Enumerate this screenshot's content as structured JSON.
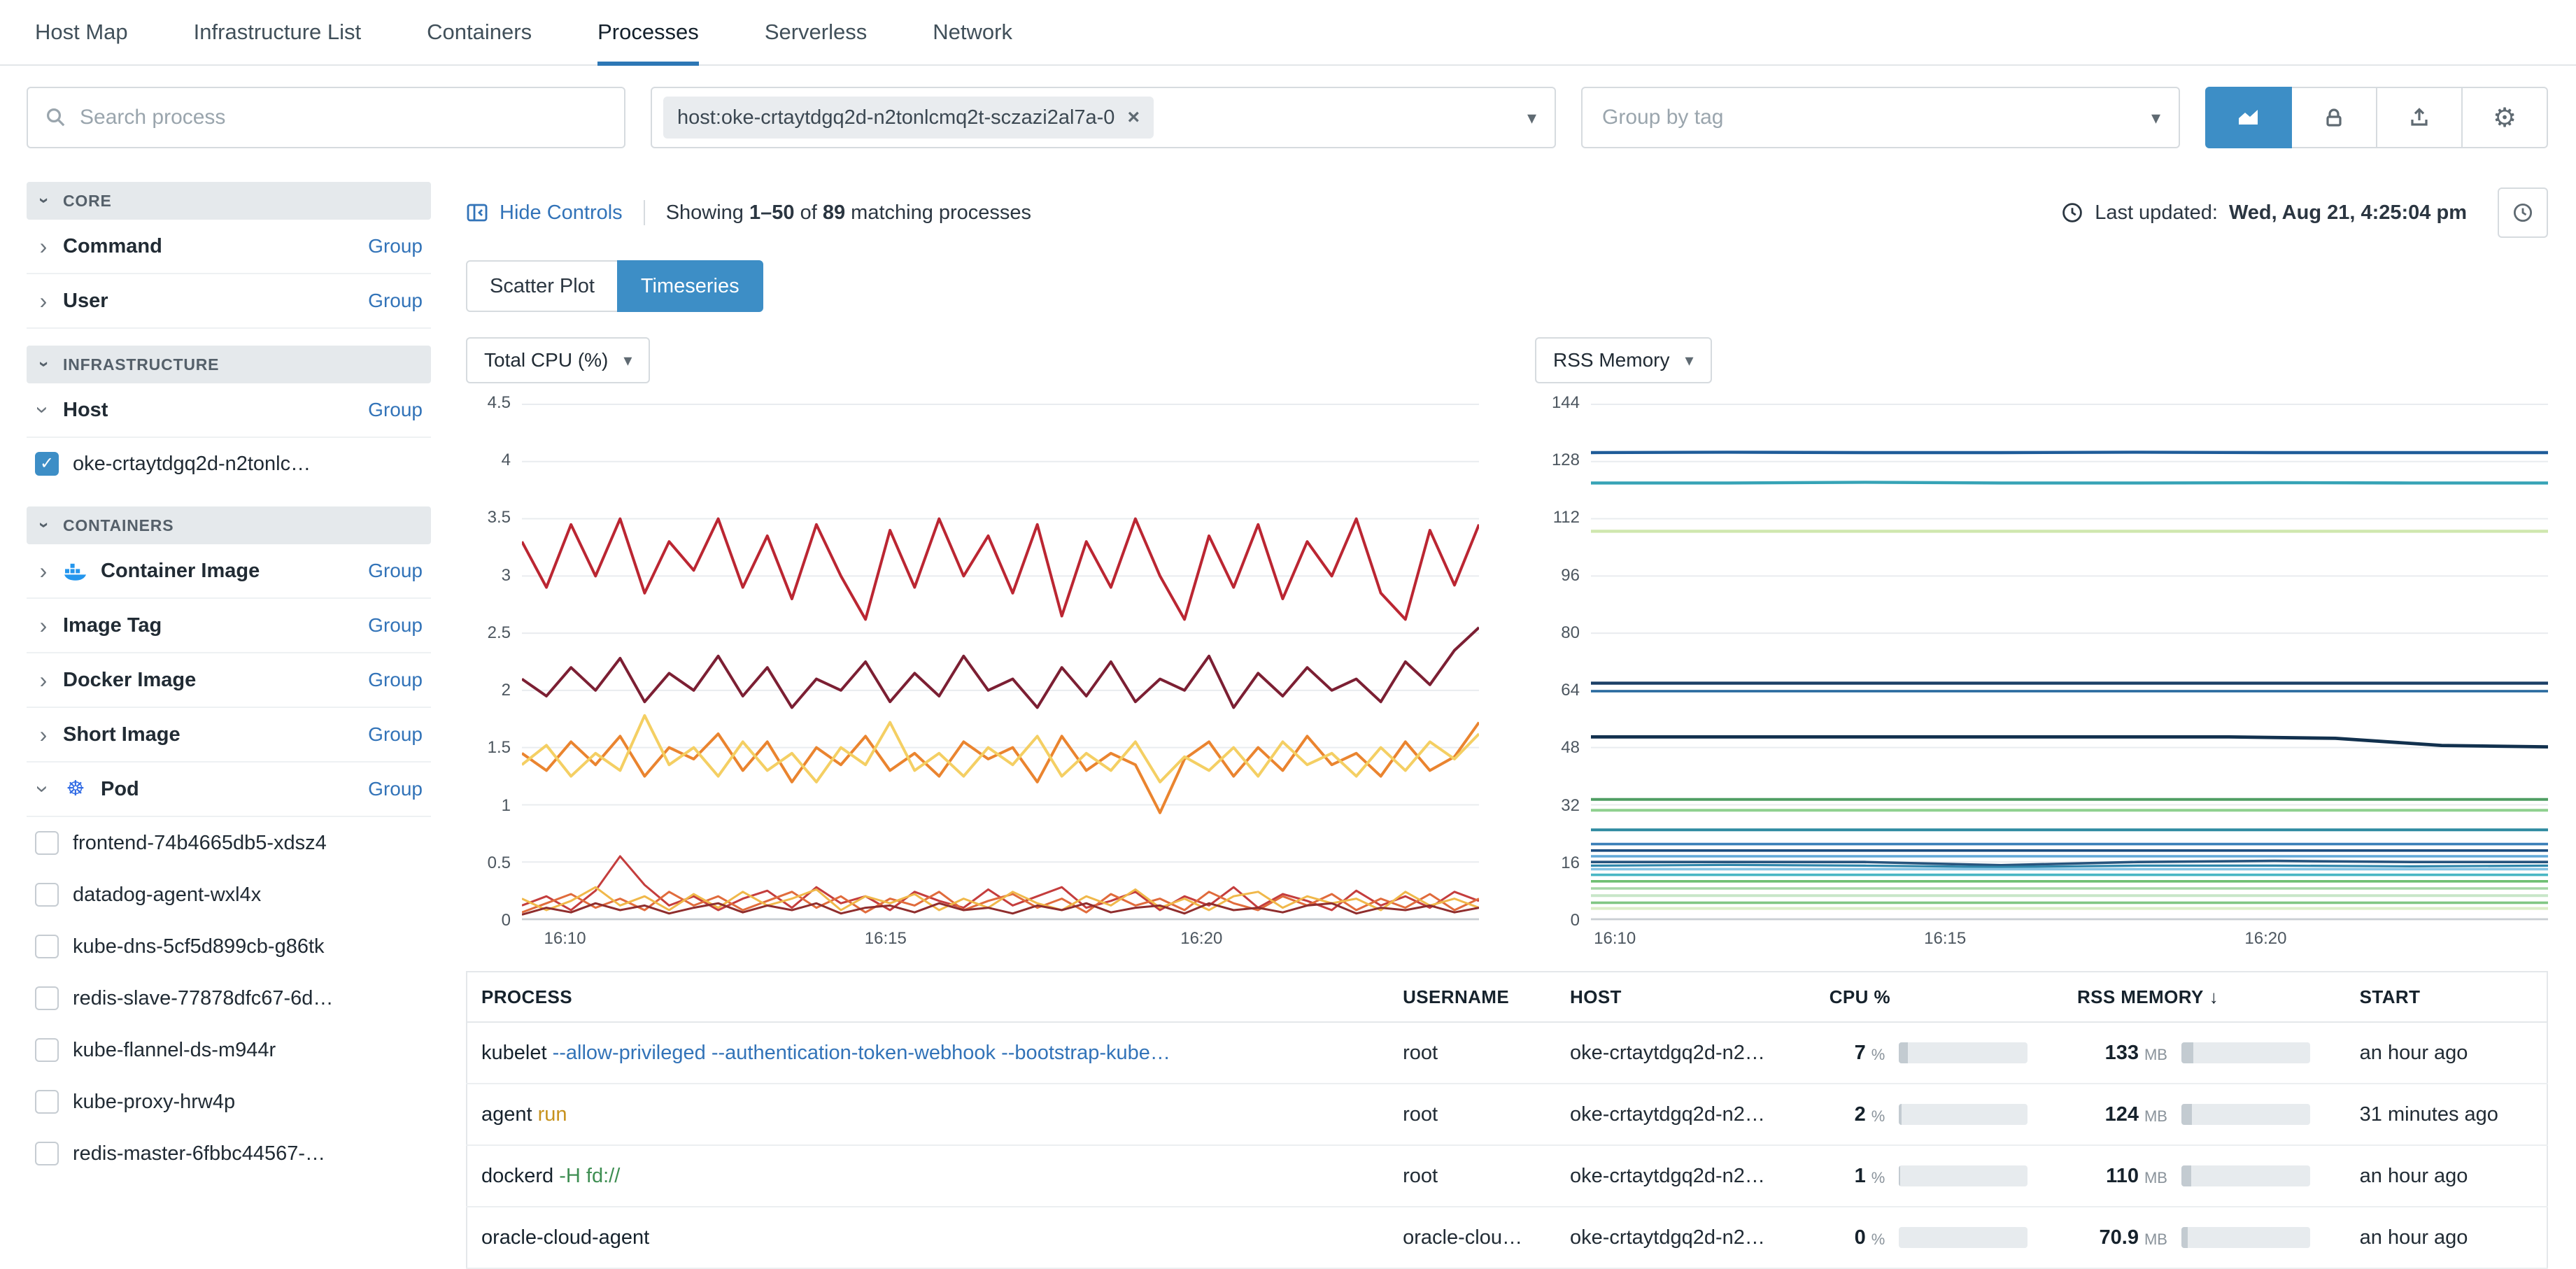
{
  "nav": {
    "items": [
      "Host Map",
      "Infrastructure List",
      "Containers",
      "Processes",
      "Serverless",
      "Network"
    ],
    "active": "Processes"
  },
  "toolbar": {
    "search_placeholder": "Search process",
    "filter_tag": "host:oke-crtaytdgq2d-n2tonlcmq2t-sczazi2al7a-0",
    "group_by_placeholder": "Group by tag"
  },
  "icons": {
    "chevron": "›",
    "caret": "▾",
    "close": "×",
    "check": "✓",
    "kubernetes": "☸",
    "gear": "⚙",
    "sort_desc": "↓"
  },
  "colors": {
    "accent": "#3d8ec6",
    "link": "#3273b8",
    "args_warn": "#c7921e",
    "args_ok": "#3e8e52",
    "docker_blue": "#2496ed",
    "kubernetes_blue": "#326ce5"
  },
  "sidebar": {
    "group_label": "Group",
    "sections": {
      "core": {
        "title": "CORE",
        "items": [
          {
            "label": "Command"
          },
          {
            "label": "User"
          }
        ]
      },
      "infrastructure": {
        "title": "INFRASTRUCTURE",
        "items": [
          {
            "label": "Host",
            "expanded": true,
            "children": [
              {
                "label": "oke-crtaytdgq2d-n2tonlc…",
                "checked": true
              }
            ]
          }
        ]
      },
      "containers": {
        "title": "CONTAINERS",
        "items": [
          {
            "label": "Container Image",
            "icon": "docker"
          },
          {
            "label": "Image Tag"
          },
          {
            "label": "Docker Image"
          },
          {
            "label": "Short Image"
          },
          {
            "label": "Pod",
            "icon": "kubernetes",
            "expanded": true,
            "children": [
              {
                "label": "frontend-74b4665db5-xdsz4",
                "checked": false
              },
              {
                "label": "datadog-agent-wxl4x",
                "checked": false
              },
              {
                "label": "kube-dns-5cf5d899cb-g86tk",
                "checked": false
              },
              {
                "label": "redis-slave-77878dfc67-6d…",
                "checked": false
              },
              {
                "label": "kube-flannel-ds-m944r",
                "checked": false
              },
              {
                "label": "kube-proxy-hrw4p",
                "checked": false
              },
              {
                "label": "redis-master-6fbbc44567-…",
                "checked": false
              }
            ]
          }
        ]
      }
    }
  },
  "controls": {
    "hide_controls": "Hide Controls",
    "showing_prefix": "Showing",
    "showing_range": "1–50",
    "showing_of": "of",
    "showing_total": "89",
    "showing_suffix": "matching processes",
    "last_updated_label": "Last updated:",
    "last_updated_value": "Wed, Aug 21, 4:25:04 pm"
  },
  "tabs": {
    "scatter": "Scatter Plot",
    "timeseries": "Timeseries",
    "active": "Timeseries"
  },
  "charts": [
    {
      "type": "line",
      "selector_label": "Total CPU (%)",
      "ylim": [
        0,
        4.5
      ],
      "y_ticks": [
        "4.5",
        "4",
        "3.5",
        "3",
        "2.5",
        "2",
        "1.5",
        "1",
        "0.5",
        "0"
      ],
      "x_ticks": [
        "16:10",
        "16:15",
        "16:20"
      ],
      "series": [
        {
          "color": "#bb2632",
          "w": 2,
          "values": [
            3.3,
            2.9,
            3.45,
            3.0,
            3.5,
            2.85,
            3.3,
            3.05,
            3.5,
            2.9,
            3.35,
            2.8,
            3.45,
            3.0,
            2.62,
            3.4,
            2.9,
            3.5,
            3.0,
            3.35,
            2.85,
            3.45,
            2.65,
            3.3,
            2.9,
            3.5,
            3.0,
            2.62,
            3.35,
            2.9,
            3.45,
            2.8,
            3.3,
            3.0,
            3.5,
            2.85,
            2.62,
            3.4,
            2.92,
            3.45
          ]
        },
        {
          "color": "#7c1f33",
          "w": 2,
          "values": [
            2.1,
            1.95,
            2.2,
            2.0,
            2.28,
            1.9,
            2.15,
            2.0,
            2.3,
            1.95,
            2.2,
            1.85,
            2.1,
            2.0,
            2.25,
            1.9,
            2.15,
            1.95,
            2.3,
            2.0,
            2.1,
            1.85,
            2.2,
            1.95,
            2.25,
            1.9,
            2.1,
            2.0,
            2.3,
            1.85,
            2.15,
            1.95,
            2.2,
            2.0,
            2.1,
            1.9,
            2.25,
            2.05,
            2.35,
            2.55
          ]
        },
        {
          "color": "#ea842f",
          "w": 2,
          "values": [
            1.45,
            1.3,
            1.55,
            1.35,
            1.6,
            1.25,
            1.5,
            1.4,
            1.62,
            1.3,
            1.55,
            1.2,
            1.5,
            1.35,
            1.6,
            1.3,
            1.45,
            1.25,
            1.55,
            1.4,
            1.5,
            1.2,
            1.6,
            1.3,
            1.45,
            1.35,
            0.93,
            1.4,
            1.55,
            1.25,
            1.5,
            1.3,
            1.6,
            1.35,
            1.45,
            1.25,
            1.55,
            1.3,
            1.42,
            1.72
          ]
        },
        {
          "color": "#f4cf63",
          "w": 2,
          "values": [
            1.35,
            1.52,
            1.25,
            1.45,
            1.3,
            1.78,
            1.35,
            1.5,
            1.25,
            1.55,
            1.3,
            1.45,
            1.2,
            1.5,
            1.35,
            1.72,
            1.3,
            1.45,
            1.25,
            1.5,
            1.35,
            1.6,
            1.25,
            1.45,
            1.3,
            1.55,
            1.2,
            1.42,
            1.3,
            1.5,
            1.25,
            1.55,
            1.35,
            1.45,
            1.25,
            1.5,
            1.3,
            1.55,
            1.4,
            1.62
          ]
        },
        {
          "color": "#c43d3d",
          "w": 1.5,
          "values": [
            0.12,
            0.2,
            0.08,
            0.25,
            0.55,
            0.3,
            0.12,
            0.2,
            0.08,
            0.18,
            0.25,
            0.1,
            0.28,
            0.14,
            0.2,
            0.08,
            0.24,
            0.16,
            0.1,
            0.26,
            0.12,
            0.2,
            0.28,
            0.1,
            0.16,
            0.24,
            0.08,
            0.2,
            0.12,
            0.28,
            0.1,
            0.22,
            0.16,
            0.08,
            0.25,
            0.12,
            0.2,
            0.1,
            0.24,
            0.16
          ]
        },
        {
          "color": "#e06b3c",
          "w": 1.5,
          "values": [
            0.06,
            0.14,
            0.22,
            0.1,
            0.18,
            0.08,
            0.24,
            0.12,
            0.2,
            0.08,
            0.16,
            0.24,
            0.1,
            0.2,
            0.06,
            0.18,
            0.12,
            0.24,
            0.08,
            0.16,
            0.22,
            0.1,
            0.18,
            0.06,
            0.22,
            0.12,
            0.18,
            0.08,
            0.24,
            0.14,
            0.08,
            0.2,
            0.12,
            0.22,
            0.08,
            0.18,
            0.1,
            0.22,
            0.08,
            0.18
          ]
        },
        {
          "color": "#f0b84a",
          "w": 1.5,
          "values": [
            0.18,
            0.08,
            0.16,
            0.28,
            0.12,
            0.2,
            0.08,
            0.22,
            0.1,
            0.24,
            0.12,
            0.18,
            0.26,
            0.08,
            0.2,
            0.14,
            0.22,
            0.08,
            0.18,
            0.1,
            0.24,
            0.14,
            0.08,
            0.2,
            0.12,
            0.26,
            0.1,
            0.18,
            0.08,
            0.2,
            0.24,
            0.1,
            0.2,
            0.14,
            0.18,
            0.08,
            0.24,
            0.12,
            0.18,
            0.1
          ]
        },
        {
          "color": "#8f2d2d",
          "w": 1.5,
          "values": [
            0.04,
            0.1,
            0.06,
            0.14,
            0.08,
            0.12,
            0.05,
            0.1,
            0.14,
            0.06,
            0.12,
            0.08,
            0.14,
            0.05,
            0.1,
            0.12,
            0.06,
            0.14,
            0.08,
            0.1,
            0.05,
            0.12,
            0.08,
            0.14,
            0.06,
            0.1,
            0.12,
            0.05,
            0.14,
            0.08,
            0.1,
            0.06,
            0.12,
            0.14,
            0.05,
            0.1,
            0.08,
            0.12,
            0.06,
            0.1
          ]
        }
      ]
    },
    {
      "type": "line",
      "selector_label": "RSS Memory",
      "ylim": [
        0,
        144
      ],
      "y_ticks": [
        "144",
        "128",
        "112",
        "96",
        "80",
        "64",
        "48",
        "32",
        "16",
        "0"
      ],
      "x_ticks": [
        "16:10",
        "16:15",
        "16:20"
      ],
      "series": [
        {
          "color": "#1f5c99",
          "w": 2.2,
          "values": [
            130.5,
            130.6,
            130.5,
            130.5,
            130.6,
            130.5,
            130.5,
            130.5
          ]
        },
        {
          "color": "#36a3b6",
          "w": 2.2,
          "values": [
            122,
            122,
            122.2,
            122,
            122,
            122.1,
            122,
            122
          ]
        },
        {
          "color": "#cfe7ae",
          "w": 2.2,
          "values": [
            108.5,
            108.5
          ]
        },
        {
          "color": "#1b3f66",
          "w": 2.2,
          "values": [
            66,
            66
          ]
        },
        {
          "color": "#27699e",
          "w": 1.8,
          "values": [
            63.8,
            63.8
          ]
        },
        {
          "color": "#12314e",
          "w": 2.4,
          "values": [
            51,
            51,
            51,
            51,
            51,
            51,
            51,
            50.6,
            48.6,
            48.2
          ]
        },
        {
          "color": "#4f9e63",
          "w": 2,
          "values": [
            33.5,
            33.5
          ]
        },
        {
          "color": "#8fd08f",
          "w": 2,
          "values": [
            30.5,
            30.5
          ]
        },
        {
          "color": "#2f8ba1",
          "w": 2,
          "values": [
            25,
            25
          ]
        },
        {
          "color": "#3a7fb8",
          "w": 1.8,
          "values": [
            21,
            21
          ]
        },
        {
          "color": "#1c4e80",
          "w": 1.8,
          "values": [
            19.2,
            19.2
          ]
        },
        {
          "color": "#62a8d8",
          "w": 1.8,
          "values": [
            17.6,
            17.6
          ]
        },
        {
          "color": "#27547d",
          "w": 1.8,
          "values": [
            16,
            16,
            16,
            15.1,
            16,
            16.3,
            16,
            16
          ]
        },
        {
          "color": "#2e86ab",
          "w": 1.6,
          "values": [
            15,
            15.2,
            15,
            14.6,
            15,
            15,
            14.8,
            15
          ]
        },
        {
          "color": "#86c3e3",
          "w": 1.8,
          "values": [
            14,
            14
          ]
        },
        {
          "color": "#49b6c4",
          "w": 1.8,
          "values": [
            12.4,
            12.4
          ]
        },
        {
          "color": "#6fbf73",
          "w": 1.8,
          "values": [
            10.6,
            10.6
          ]
        },
        {
          "color": "#a5d6a7",
          "w": 1.8,
          "values": [
            8.6,
            8.6
          ]
        },
        {
          "color": "#c8e6c9",
          "w": 2,
          "values": [
            6.6,
            6.6
          ]
        },
        {
          "color": "#81c784",
          "w": 1.8,
          "values": [
            4.6,
            4.6
          ]
        },
        {
          "color": "#dcedc8",
          "w": 2,
          "values": [
            3,
            3
          ]
        }
      ]
    }
  ],
  "table": {
    "headers": [
      "PROCESS",
      "USERNAME",
      "HOST",
      "CPU %",
      "RSS MEMORY",
      "START"
    ],
    "sort_column": "RSS MEMORY",
    "units": {
      "cpu": "%",
      "rss": "MB"
    },
    "rows": [
      {
        "process": "kubelet",
        "args": "--allow-privileged --authentication-token-webhook --bootstrap-kube…",
        "username": "root",
        "host": "oke-crtaytdgq2d-n2…",
        "cpu": "7",
        "cpu_frac": 0.07,
        "rss": "133",
        "rss_frac": 0.09,
        "start": "an hour ago"
      },
      {
        "process": "agent",
        "args": "run",
        "username": "root",
        "host": "oke-crtaytdgq2d-n2…",
        "cpu": "2",
        "cpu_frac": 0.02,
        "rss": "124",
        "rss_frac": 0.084,
        "start": "31 minutes ago"
      },
      {
        "process": "dockerd",
        "args": "-H fd://",
        "username": "root",
        "host": "oke-crtaytdgq2d-n2…",
        "cpu": "1",
        "cpu_frac": 0.01,
        "rss": "110",
        "rss_frac": 0.075,
        "start": "an hour ago"
      },
      {
        "process": "oracle-cloud-agent",
        "args": "",
        "username": "oracle-clou…",
        "host": "oke-crtaytdgq2d-n2…",
        "cpu": "0",
        "cpu_frac": 0.0,
        "rss": "70.9",
        "rss_frac": 0.048,
        "start": "an hour ago"
      }
    ]
  }
}
